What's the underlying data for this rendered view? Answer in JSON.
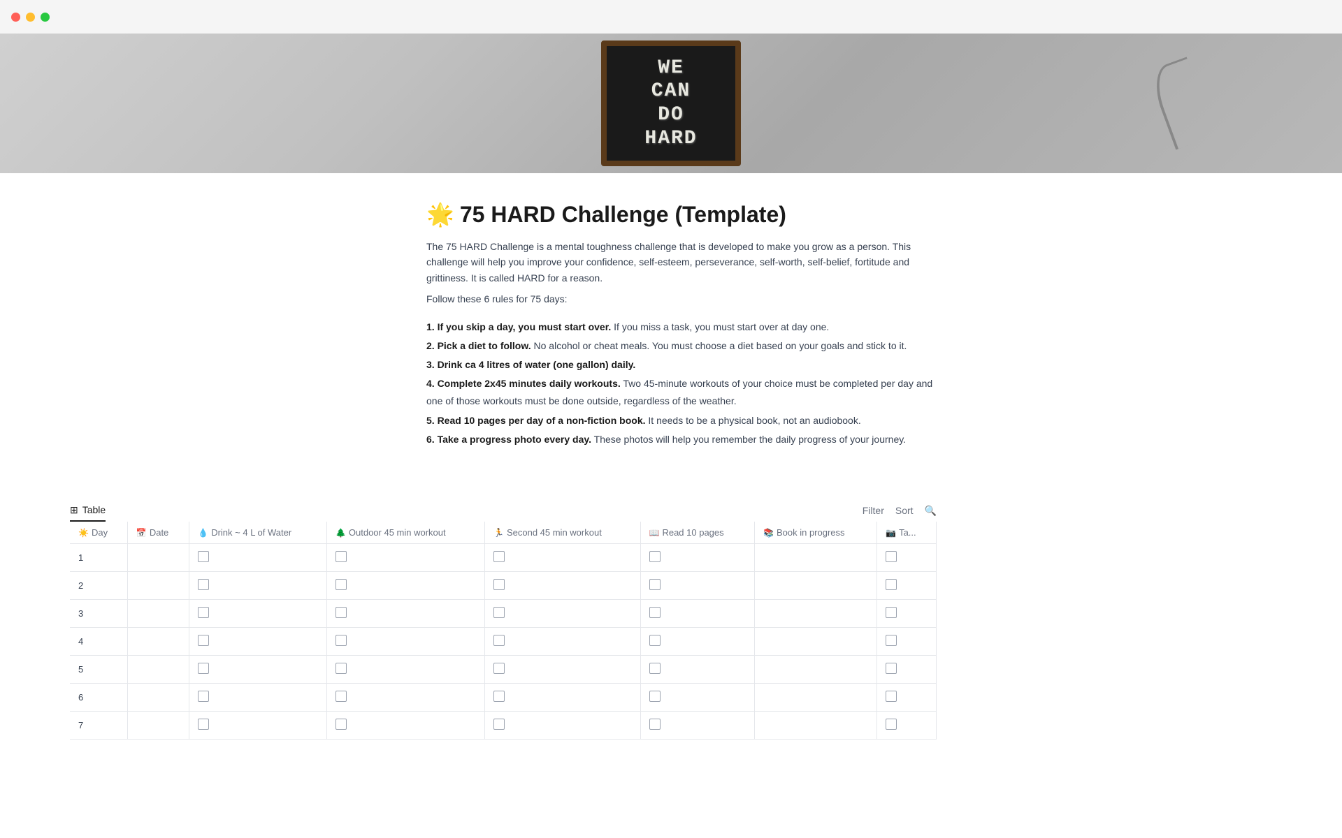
{
  "window": {
    "title": "75 HARD Challenge (Template)"
  },
  "traffic_lights": {
    "red": "close",
    "yellow": "minimize",
    "green": "maximize"
  },
  "hero": {
    "chalkboard_lines": [
      "WE",
      "CAN",
      "DO",
      "HARD"
    ]
  },
  "page": {
    "emoji": "🌟",
    "title": "75 HARD Challenge (Template)",
    "description1": "The 75 HARD Challenge is a mental toughness challenge that is developed to make you grow as a person. This challenge will help you improve your confidence, self-esteem, perseverance, self-worth, self-belief, fortitude and grittiness. It is called HARD for a reason.",
    "description2": "Follow these 6 rules for 75 days:",
    "rules": [
      {
        "number": "1.",
        "bold": "If you skip a day, you must start over.",
        "rest": " If you miss a task, you must start over at day one."
      },
      {
        "number": "2.",
        "bold": "Pick a diet to follow.",
        "rest": " No alcohol or cheat meals. You must choose a diet based on your goals and stick to it."
      },
      {
        "number": "3.",
        "bold": "Drink ca 4 litres of water (one gallon) daily.",
        "rest": ""
      },
      {
        "number": "4.",
        "bold": "Complete 2x45 minutes daily workouts.",
        "rest": " Two 45-minute workouts of your choice must be completed per day and one of those workouts must be done outside, regardless of the weather."
      },
      {
        "number": "5.",
        "bold": "Read 10 pages per day of a non-fiction book.",
        "rest": " It needs to be a physical book, not an audiobook."
      },
      {
        "number": "6.",
        "bold": "Take a progress photo every day.",
        "rest": " These photos will help you remember the daily progress of your journey."
      }
    ]
  },
  "table": {
    "tab_label": "Table",
    "tab_icon": "⊞",
    "filter_label": "Filter",
    "sort_label": "Sort",
    "search_icon": "🔍",
    "columns": [
      {
        "icon": "☀️",
        "label": "Day"
      },
      {
        "icon": "📅",
        "label": "Date"
      },
      {
        "icon": "💧",
        "label": "Drink ~ 4 L of Water"
      },
      {
        "icon": "🌲",
        "label": "Outdoor 45 min workout"
      },
      {
        "icon": "🏃",
        "label": "Second 45 min workout"
      },
      {
        "icon": "📖",
        "label": "Read 10 pages"
      },
      {
        "icon": "📚",
        "label": "Book in progress"
      },
      {
        "icon": "📷",
        "label": "Ta..."
      }
    ],
    "rows": [
      {
        "day": "1",
        "date": ""
      },
      {
        "day": "2",
        "date": ""
      },
      {
        "day": "3",
        "date": ""
      },
      {
        "day": "4",
        "date": ""
      },
      {
        "day": "5",
        "date": ""
      },
      {
        "day": "6",
        "date": ""
      },
      {
        "day": "7",
        "date": ""
      }
    ]
  }
}
